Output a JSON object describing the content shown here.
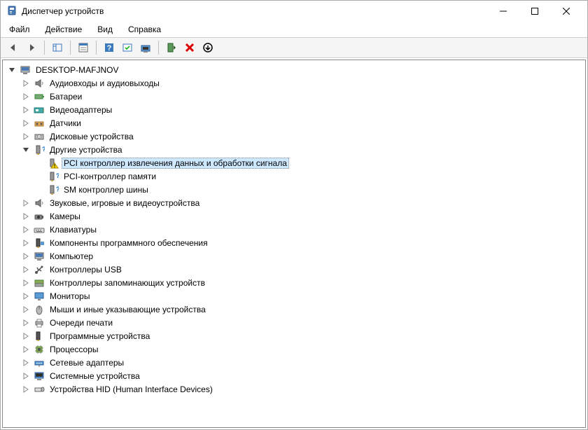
{
  "window": {
    "title": "Диспетчер устройств"
  },
  "menu": {
    "file": "Файл",
    "action": "Действие",
    "view": "Вид",
    "help": "Справка"
  },
  "tree": {
    "root": "DESKTOP-MAFJNOV",
    "cat": {
      "audio_io": "Аудиовходы и аудиовыходы",
      "battery": "Батареи",
      "display": "Видеоадаптеры",
      "sensors": "Датчики",
      "disk": "Дисковые устройства",
      "other": "Другие устройства",
      "sound": "Звуковые, игровые и видеоустройства",
      "camera": "Камеры",
      "keyboard": "Клавиатуры",
      "software": "Компоненты программного обеспечения",
      "computer": "Компьютер",
      "usb": "Контроллеры USB",
      "storage": "Контроллеры запоминающих устройств",
      "monitor": "Мониторы",
      "mouse": "Мыши и иные указывающие устройства",
      "printq": "Очереди печати",
      "firmware": "Программные устройства",
      "cpu": "Процессоры",
      "network": "Сетевые адаптеры",
      "system": "Системные устройства",
      "hid": "Устройства HID (Human Interface Devices)"
    },
    "other_devices": {
      "pci_signal": "PCI контроллер извлечения данных и обработки сигнала",
      "pci_memory": "PCI-контроллер памяти",
      "sm_bus": "SM контроллер шины"
    }
  }
}
